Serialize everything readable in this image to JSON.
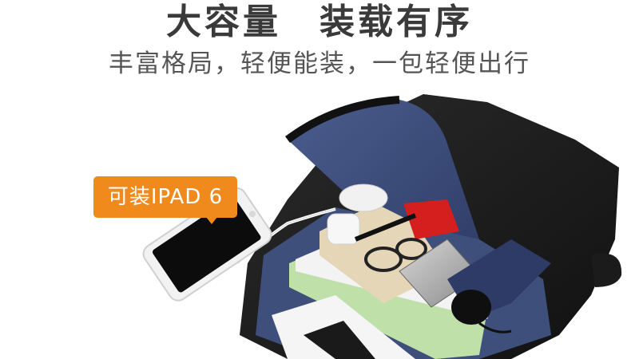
{
  "headline": "大容量　装载有序",
  "subheadline": "丰富格局，轻便能装，一包轻便出行",
  "badge": {
    "text": "可装IPAD 6",
    "color": "#f08a1c"
  },
  "colors": {
    "background": "#ffffff",
    "headline": "#3a3a3a",
    "subheadline": "#555555"
  }
}
